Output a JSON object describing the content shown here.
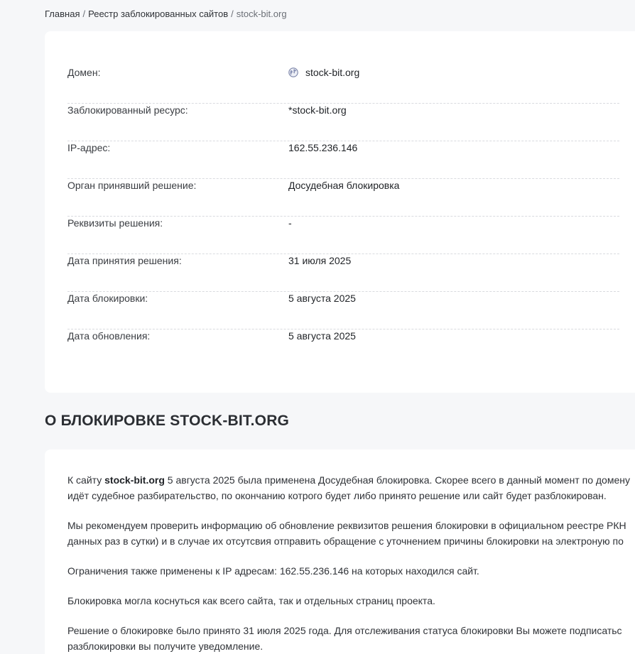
{
  "breadcrumb": {
    "home": "Главная",
    "registry": "Реестр заблокированных сайтов",
    "current": "stock-bit.org",
    "separator": "/"
  },
  "info": {
    "rows": [
      {
        "label": "Домен:",
        "value": "stock-bit.org"
      },
      {
        "label": "Заблокированный ресурс:",
        "value": "*stock-bit.org"
      },
      {
        "label": "IP-адрес:",
        "value": "162.55.236.146"
      },
      {
        "label": "Орган принявший решение:",
        "value": "Досудебная блокировка"
      },
      {
        "label": "Реквизиты решения:",
        "value": "-"
      },
      {
        "label": "Дата принятия решения:",
        "value": "31 июля 2025"
      },
      {
        "label": "Дата блокировки:",
        "value": "5 августа 2025"
      },
      {
        "label": "Дата обновления:",
        "value": "5 августа 2025"
      }
    ]
  },
  "about": {
    "title": "О БЛОКИРОВКЕ STOCK-BIT.ORG",
    "p1_prefix": "К сайту ",
    "p1_domain": "stock-bit.org",
    "p1_rest_line1": " 5 августа 2025 была применена Досудебная блокировка. Скорее всего в данный момент по домену",
    "p1_line2": "идёт судебное разбирательство, по окончанию котрого будет либо принято решение или сайт будет разблокирован.",
    "p2_line1": "Мы рекомендуем проверить информацию об обновление реквизитов решения блокировки в официальном реестре РКН",
    "p2_line2": "данных раз в сутки) и в случае их отсутсвия отправить обращение с уточнением причины блокировки на электроную по",
    "p3": "Ограничения также применены к IP адресам: 162.55.236.146 на которых находился сайт.",
    "p4": "Блокировка могла коснуться как всего сайта, так и отдельных страниц проекта.",
    "p5_line1": "Решение о блокировке было принято 31 июля 2025 года. Для отслеживания статуса блокировки Вы можете подписатьс",
    "p5_line2": "разблокировки вы получите уведомление."
  },
  "icons": {
    "domain": "globe-icon"
  },
  "colors": {
    "background": "#f6f7f9",
    "card": "#ffffff",
    "text": "#2b2e33",
    "divider": "#d9dbdf"
  }
}
